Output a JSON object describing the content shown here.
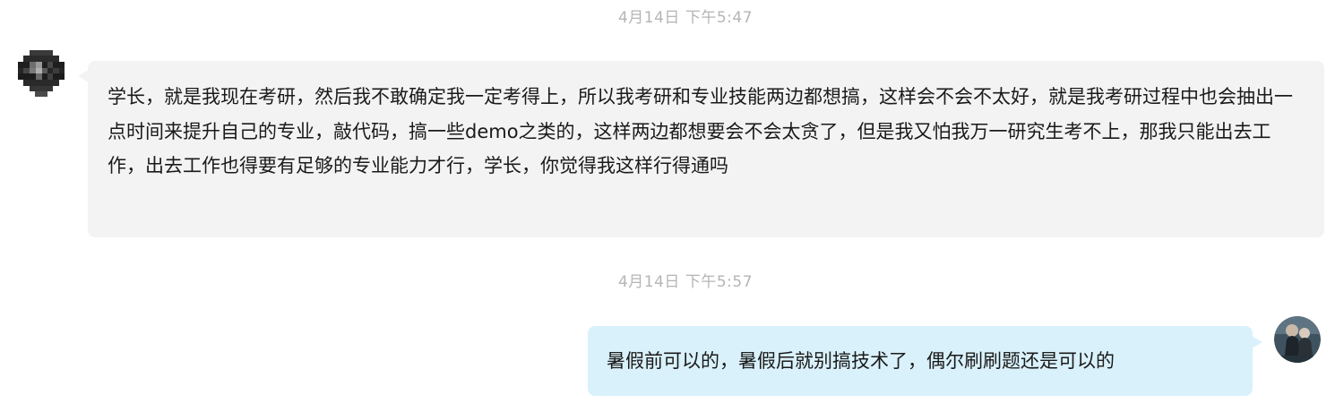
{
  "messages": [
    {
      "timestamp": "4月14日 下午5:47",
      "direction": "incoming",
      "text": "学长，就是我现在考研，然后我不敢确定我一定考得上，所以我考研和专业技能两边都想搞，这样会不会不太好，就是我考研过程中也会抽出一点时间来提升自己的专业，敲代码，搞一些demo之类的，这样两边都想要会不会太贪了，但是我又怕我万一研究生考不上，那我只能出去工作，出去工作也得要有足够的专业能力才行，学长，你觉得我这样行得通吗"
    },
    {
      "timestamp": "4月14日 下午5:57",
      "direction": "outgoing",
      "text": "暑假前可以的，暑假后就别搞技术了，偶尔刷刷题还是可以的"
    }
  ],
  "colors": {
    "incoming_bubble": "#f3f3f3",
    "outgoing_bubble": "#d9f1fb",
    "timestamp": "#b5b5b5"
  }
}
